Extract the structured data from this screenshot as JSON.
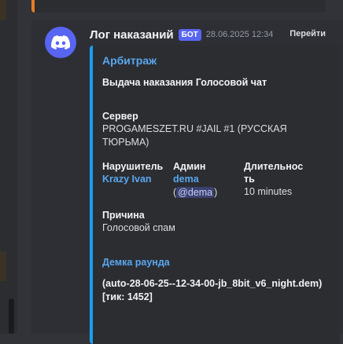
{
  "message": {
    "author": "Лог наказаний",
    "bot_tag": "БОТ",
    "timestamp": "28.06.2025 12:34",
    "jump_label": "Перейти"
  },
  "embed": {
    "accent_color": "#1a9ff0",
    "author_name": "Арбитраж",
    "title": "Выдача наказания Голосовой чат",
    "server_label": "Сервер",
    "server_value": "PROGAMESZET.RU #JAIL #1 (РУССКАЯ ТЮРЬМА)",
    "offender_label": "Нарушитель",
    "offender_value": "Krazy Ivan",
    "admin_label": "Админ",
    "admin_name": "dema",
    "admin_open_paren": "(",
    "admin_mention": "@dema",
    "admin_close_paren": ")",
    "duration_label": "Длительнос ть",
    "duration_value": "10 minutes",
    "reason_label": "Причина",
    "reason_value": "Голосовой спам",
    "demo_link": "Демка раунда",
    "demo_file": "(auto-28-06-25--12-34-00-jb_8bit_v6_night.dem) [тик: 1452]"
  },
  "colors": {
    "background": "#323339",
    "embed_background": "#2b2d31",
    "link": "#5aa7f0",
    "bot_tag": "#5865f2"
  }
}
